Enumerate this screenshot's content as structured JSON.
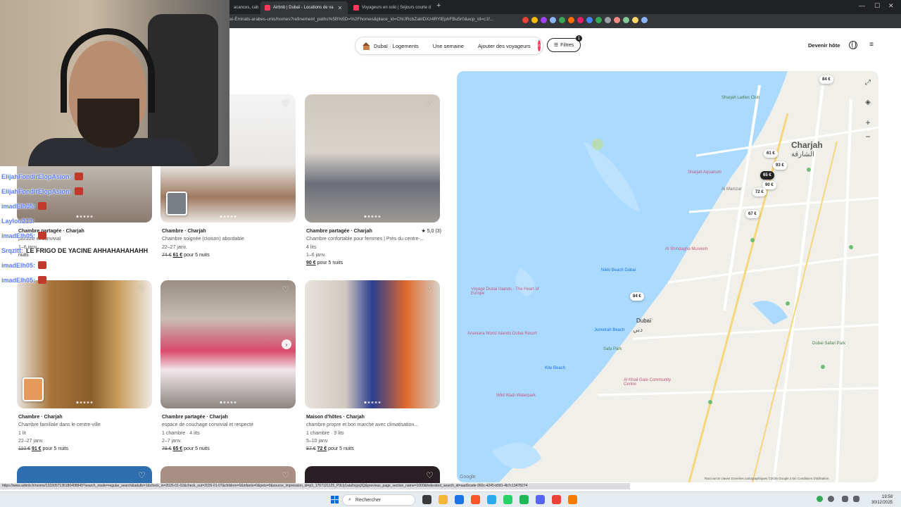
{
  "browser": {
    "tabs": [
      {
        "label": "acances, cab"
      },
      {
        "label": "Airbnb | Dubaï - Locations de va"
      },
      {
        "label": "Voyageurs en solo | Séjours courte d"
      }
    ],
    "url": "ai-Émirats-arabes-unis/homes?refinement_paths%5B%5D=%2Fhomes&place_id=ChIJRcbZaklDXz4RYlEphFBu5r0&acp_id=c1f..."
  },
  "header": {
    "location": "Dubaï · Logements",
    "dates": "Une semaine",
    "guests": "Ajouter des voyageurs",
    "filters": "Filtres",
    "filters_count": "1",
    "host": "Devenir hôte"
  },
  "chat": [
    {
      "user": "ElijahFondirElopAsion:",
      "msg": ""
    },
    {
      "user": "ElijahFondirElopAsion:",
      "msg": ""
    },
    {
      "user": "imadElh05:",
      "msg": ""
    },
    {
      "user": "Laylou213:",
      "msg": ""
    },
    {
      "user": "imadElh05:",
      "msg": ""
    },
    {
      "user": "Srqzitt:",
      "msg": "LE FRIGO DE YACINE AHHAHAHAHAHH"
    },
    {
      "user": "imadElh05:",
      "msg": ""
    },
    {
      "user": "imadElh05:",
      "msg": ""
    }
  ],
  "listings": [
    {
      "title": "Chambre partagée · Charjah",
      "desc": "paisible et convivial",
      "beds": "",
      "dates": "1–6 janv.",
      "old_price": "",
      "price": "",
      "suffix": "nuits",
      "rating": ""
    },
    {
      "title": "Chambre · Charjah",
      "desc": "Chambre soignée (cloison) abordable",
      "beds": "",
      "dates": "22–27 janv.",
      "old_price": "74 €",
      "price": "61 €",
      "suffix": "pour 5 nuits",
      "rating": ""
    },
    {
      "title": "Chambre partagée · Charjah",
      "desc": "Chambre confortable pour femmes | Près du centre-...",
      "beds": "4 lits",
      "dates": "1–6 janv.",
      "old_price": "",
      "price": "90 €",
      "suffix": "pour 5 nuits",
      "rating": "★ 5,0 (3)"
    },
    {
      "title": "Chambre · Charjah",
      "desc": "Chambre familiale dans le centre-ville",
      "beds": "1 lit",
      "dates": "22–27 janv.",
      "old_price": "110 €",
      "price": "91 €",
      "suffix": "pour 5 nuits",
      "rating": ""
    },
    {
      "title": "Chambre partagée · Charjah",
      "desc": "espace de couchage convivial et respecté",
      "beds": "1 chambre · 4 lits",
      "dates": "2–7 janv.",
      "old_price": "78 €",
      "price": "65 €",
      "suffix": "pour 5 nuits",
      "rating": ""
    },
    {
      "title": "Maison d'hôtes · Charjah",
      "desc": "chambre propre et bon marché avec climatisation...",
      "beds": "1 chambre · 3 lits",
      "dates": "5–10 janv.",
      "old_price": "87 €",
      "price": "72 €",
      "suffix": "pour 5 nuits",
      "rating": ""
    }
  ],
  "map": {
    "pins": [
      "84 €",
      "61 €",
      "93 €",
      "65 €",
      "90 €",
      "72 €",
      "67 €",
      "84 €"
    ],
    "labels": {
      "sharjah": "Charjah",
      "sharjah_ar": "الشارقة",
      "dubai": "Dubaï",
      "dubai_ar": "دبي",
      "ladies_club": "Sharjah Ladies Club",
      "aquarium": "Sharjah Aquarium",
      "al_mamzar": "Al Mamzar",
      "al_shindagha": "Al Shindagha Museum",
      "nikki_beach": "Nikki Beach Dubai",
      "jumeirah_beach": "Jumeirah Beach",
      "safa_park": "Safa Park",
      "kite_beach": "Kite Beach",
      "al_khail": "Al Khail Gate Community Centre",
      "wild_wadi": "Wild Wadi Waterpark",
      "dubai_safari": "Dubai Safari Park",
      "the_heart": "Voyage Dubai Islands - The Heart of Europe",
      "anantara": "Anantara World Islands Dubai Resort"
    },
    "footer": "Raccourcis clavier   Données cartographiques ©2025 Google   2 km   Conditions d'utilisation",
    "google": "Google"
  },
  "status_url": "https://www.airbnb.fr/rooms/1315057136180408849?search_mode=regular_search&adults=1&check_in=2026-01-02&check_out=2026-01-07&children=0&infants=0&pets=0&source_impression_id=p3_1767121125_P3lJy1aIa5njyq3Q&previous_page_section_name=1000&federated_search_id=aad9cade-960c-4245-b581-4b7c13478274",
  "taskbar": {
    "search": "Rechercher",
    "time": "19:58",
    "date": "30/12/2025"
  }
}
